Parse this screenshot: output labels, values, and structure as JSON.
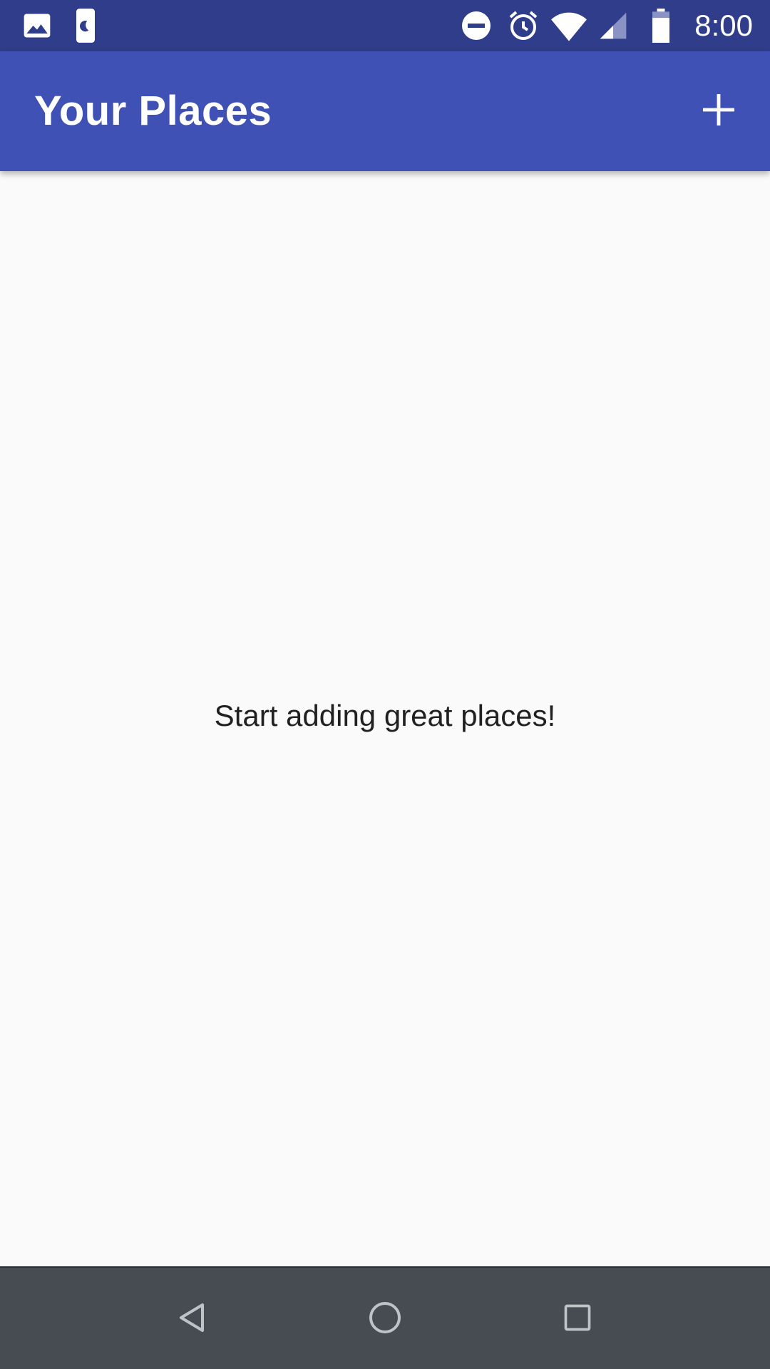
{
  "status_bar": {
    "time": "8:00",
    "left_icons": [
      "image-icon",
      "sleep-phone-icon"
    ],
    "right_icons": [
      "do-not-disturb-icon",
      "alarm-icon",
      "wifi-icon",
      "cell-signal-icon",
      "battery-icon"
    ],
    "background": "#2f3d8a"
  },
  "app_bar": {
    "title": "Your Places",
    "action_icon": "add-icon",
    "background": "#3f51b5"
  },
  "content": {
    "empty_message": "Start adding great places!",
    "background": "#fafafa"
  },
  "nav_bar": {
    "buttons": [
      "back-icon",
      "home-icon",
      "recents-icon"
    ],
    "background": "#464c51"
  }
}
